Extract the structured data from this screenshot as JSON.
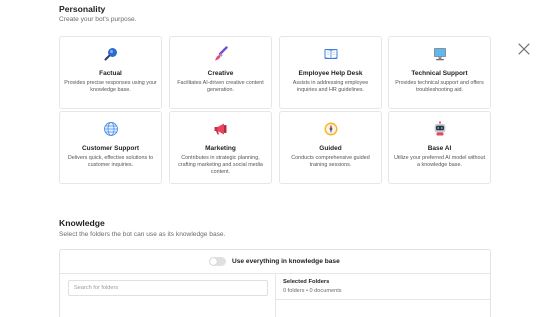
{
  "personality": {
    "title": "Personality",
    "subtitle": "Create your bot's purpose.",
    "cards": [
      {
        "icon": "magnifier-icon",
        "title": "Factual",
        "desc": "Provides precise responses using your knowledge base."
      },
      {
        "icon": "paintbrush-icon",
        "title": "Creative",
        "desc": "Facilitates AI-driven creative content generation."
      },
      {
        "icon": "book-icon",
        "title": "Employee Help Desk",
        "desc": "Assists in addressing employee inquiries and HR guidelines."
      },
      {
        "icon": "computer-icon",
        "title": "Technical Support",
        "desc": "Provides technical support and offers troubleshooting aid."
      },
      {
        "icon": "globe-icon",
        "title": "Customer Support",
        "desc": "Delivers quick, effective solutions to customer inquiries."
      },
      {
        "icon": "megaphone-icon",
        "title": "Marketing",
        "desc": "Contributes in strategic planning, crafting marketing and social media content."
      },
      {
        "icon": "compass-icon",
        "title": "Guided",
        "desc": "Conducts comprehensive guided training sessions."
      },
      {
        "icon": "robot-icon",
        "title": "Base AI",
        "desc": "Utilize your preferred AI model without a knowledge base."
      }
    ]
  },
  "knowledge": {
    "title": "Knowledge",
    "subtitle": "Select the folders the bot can use as its knowledge base.",
    "toggle_label": "Use everything in knowledge base",
    "toggle_on": false,
    "search_placeholder": "Search for folders",
    "selected_title": "Selected Folders",
    "selected_count": "0 folders • 0 documents"
  },
  "colors": {
    "accent": "#2f6fd6",
    "card_border": "#e6e6e6"
  }
}
